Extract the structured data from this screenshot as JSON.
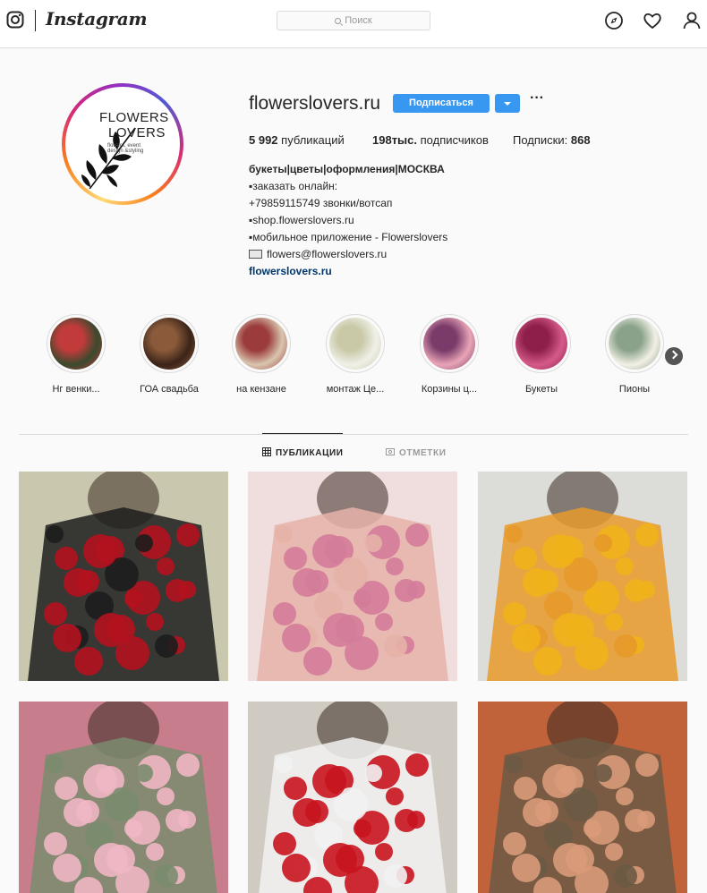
{
  "nav": {
    "wordmark": "Instagram",
    "search_placeholder": "Поиск",
    "icons": [
      "instagram-glyph-icon",
      "explore-compass-icon",
      "activity-heart-icon",
      "profile-person-icon"
    ]
  },
  "profile": {
    "username": "flowerslovers.ru",
    "follow_label": "Подписаться",
    "more_label": "···",
    "logo": {
      "line1": "FLOWERS",
      "line2": "LOVERS",
      "sub": "flowers, event design &styling"
    },
    "stats": {
      "posts_count": "5 992",
      "posts_label": "публикаций",
      "followers_count": "198тыс.",
      "followers_label": "подписчиков",
      "following_label": "Подписки:",
      "following_count": "868"
    },
    "bio": {
      "name": "букеты|цветы|оформления|МОСКВА",
      "lines": [
        "▪заказать онлайн:",
        "+79859115749 звонки/вотсап",
        "▪shop.flowerslovers.ru",
        "▪мобильное приложение - Flowerslovers"
      ],
      "email": "flowers@flowerslovers.ru",
      "link": "flowerslovers.ru"
    }
  },
  "highlights": [
    {
      "label": "Нг венки...",
      "color_a": "#3a4a2e",
      "color_b": "#c23b3b"
    },
    {
      "label": "ГОА свадьба",
      "color_a": "#3b2418",
      "color_b": "#8a5a3a"
    },
    {
      "label": "на кензане",
      "color_a": "#d9c6b0",
      "color_b": "#9b3b3b"
    },
    {
      "label": "монтаж Це...",
      "color_a": "#f0f0e8",
      "color_b": "#c9c9a8"
    },
    {
      "label": "Корзины ц...",
      "color_a": "#e9a5b7",
      "color_b": "#7a3b6a"
    },
    {
      "label": "Букеты",
      "color_a": "#d55a8a",
      "color_b": "#8e1f4a"
    },
    {
      "label": "Пионы",
      "color_a": "#f2f0e6",
      "color_b": "#8aa28a"
    }
  ],
  "tabs": [
    {
      "label": "ПУБЛИКАЦИИ",
      "icon": "grid-icon",
      "active": true
    },
    {
      "label": "ОТМЕТКИ",
      "icon": "tagged-photo-icon",
      "active": false
    }
  ],
  "posts": [
    {
      "subject": "red-roses-black-wrap",
      "bg": "#c9c7ae",
      "accent": "#b3121e",
      "wrap": "#1d1d1d"
    },
    {
      "subject": "pink-peonies",
      "bg": "#f0dede",
      "accent": "#d47c9a",
      "wrap": "#e6b3a9"
    },
    {
      "subject": "yellow-basket",
      "bg": "#dcdcd8",
      "accent": "#f0b21a",
      "wrap": "#e79a2a"
    },
    {
      "subject": "pink-ranunculus",
      "bg": "#c77d8c",
      "accent": "#f0b6c4",
      "wrap": "#7a8c6e"
    },
    {
      "subject": "red-spray-roses-white-wrap",
      "bg": "#cfcac2",
      "accent": "#c8141f",
      "wrap": "#f2f2f2"
    },
    {
      "subject": "autumn-bouquet",
      "bg": "#c0623a",
      "accent": "#d89a7a",
      "wrap": "#6c5a45"
    }
  ]
}
